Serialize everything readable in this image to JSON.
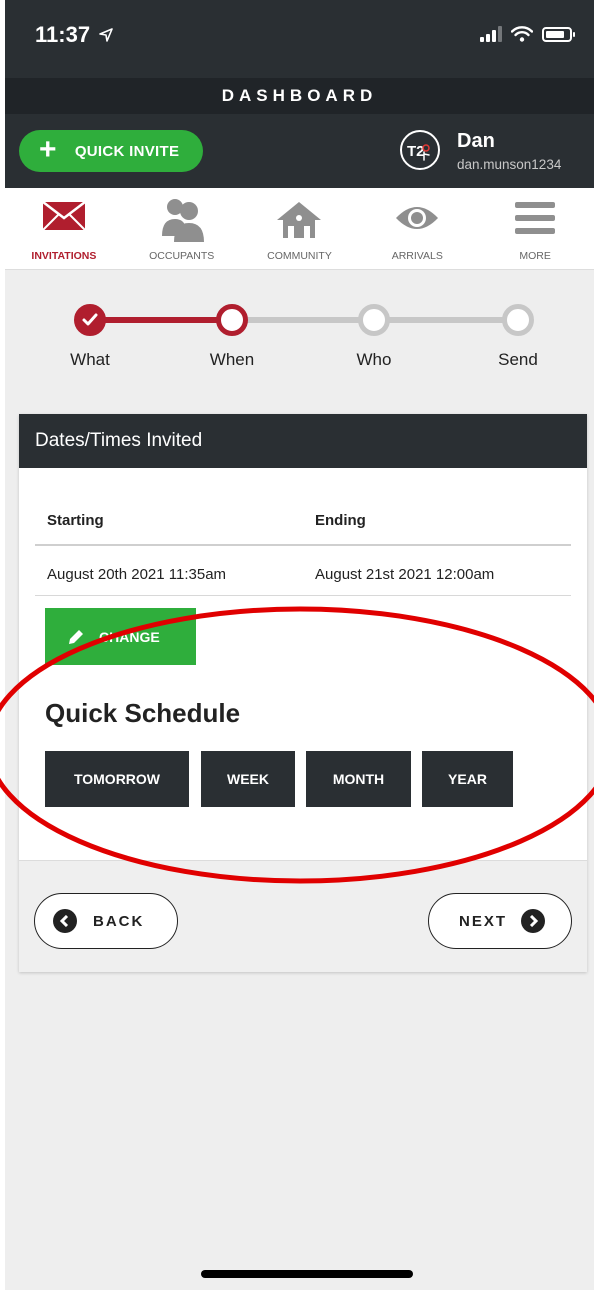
{
  "status": {
    "time": "11:37"
  },
  "title": "DASHBOARD",
  "header": {
    "quick_invite": "QUICK INVITE",
    "avatar_text": "T2",
    "user_name": "Dan",
    "user_id": "dan.munson1234"
  },
  "nav": [
    {
      "label": "INVITATIONS",
      "icon": "envelope-icon",
      "active": true
    },
    {
      "label": "OCCUPANTS",
      "icon": "people-icon",
      "active": false
    },
    {
      "label": "COMMUNITY",
      "icon": "houses-icon",
      "active": false
    },
    {
      "label": "ARRIVALS",
      "icon": "eye-icon",
      "active": false
    },
    {
      "label": "MORE",
      "icon": "menu-icon",
      "active": false
    }
  ],
  "steps": [
    {
      "label": "What",
      "state": "done"
    },
    {
      "label": "When",
      "state": "current"
    },
    {
      "label": "Who",
      "state": "pending"
    },
    {
      "label": "Send",
      "state": "pending"
    }
  ],
  "card": {
    "title": "Dates/Times Invited",
    "starting_label": "Starting",
    "ending_label": "Ending",
    "starting_value": "August 20th 2021 11:35am",
    "ending_value": "August 21st 2021 12:00am",
    "change_label": "CHANGE",
    "quick_schedule_title": "Quick Schedule",
    "quick_schedule": [
      "TOMORROW",
      "WEEK",
      "MONTH",
      "YEAR"
    ],
    "back_label": "BACK",
    "next_label": "NEXT"
  },
  "colors": {
    "accent_red": "#b01e2e",
    "green": "#2fae3c",
    "dark": "#2a2f33",
    "annotation_red": "#e00000"
  }
}
